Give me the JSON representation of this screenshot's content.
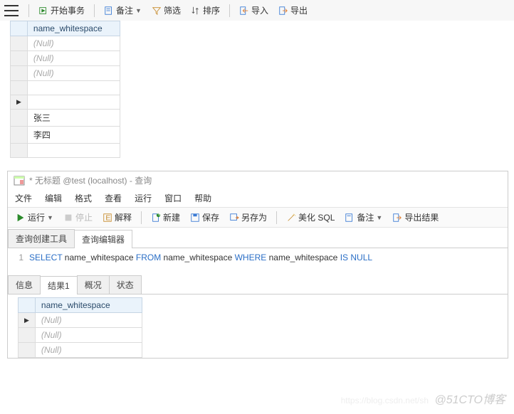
{
  "top_toolbar": {
    "begin_tx": "开始事务",
    "memo": "备注",
    "filter": "筛选",
    "sort": "排序",
    "import": "导入",
    "export": "导出"
  },
  "top_grid": {
    "header": "name_whitespace",
    "rows": [
      {
        "val": "(Null)",
        "null": true,
        "active": false
      },
      {
        "val": "(Null)",
        "null": true,
        "active": false
      },
      {
        "val": "(Null)",
        "null": true,
        "active": false
      },
      {
        "val": "",
        "null": false,
        "active": false
      },
      {
        "val": "",
        "null": false,
        "active": true
      },
      {
        "val": "张三",
        "null": false,
        "active": false
      },
      {
        "val": "李四",
        "null": false,
        "active": false
      },
      {
        "val": "",
        "null": false,
        "active": false
      }
    ]
  },
  "query_window": {
    "title": "* 无标题 @test (localhost) - 查询",
    "menus": [
      "文件",
      "编辑",
      "格式",
      "查看",
      "运行",
      "窗口",
      "帮助"
    ],
    "toolbar": {
      "run": "运行",
      "stop": "停止",
      "explain": "解释",
      "new": "新建",
      "save": "保存",
      "save_as": "另存为",
      "beautify": "美化 SQL",
      "memo": "备注",
      "export_result": "导出结果"
    },
    "tabs": [
      "查询创建工具",
      "查询编辑器"
    ],
    "active_tab": 1,
    "editor": {
      "line_no": "1",
      "tokens": [
        {
          "t": "SELECT",
          "k": true
        },
        {
          "t": " name_whitespace ",
          "k": false
        },
        {
          "t": "FROM",
          "k": true
        },
        {
          "t": " name_whitespace ",
          "k": false
        },
        {
          "t": "WHERE",
          "k": true
        },
        {
          "t": " name_whitespace ",
          "k": false
        },
        {
          "t": "IS",
          "k": true
        },
        {
          "t": " ",
          "k": false
        },
        {
          "t": "NULL",
          "k": true
        }
      ]
    },
    "result_tabs": [
      "信息",
      "结果1",
      "概况",
      "状态"
    ],
    "result_active": 1,
    "result_grid": {
      "header": "name_whitespace",
      "rows": [
        {
          "val": "(Null)",
          "null": true,
          "active": true
        },
        {
          "val": "(Null)",
          "null": true,
          "active": false
        },
        {
          "val": "(Null)",
          "null": true,
          "active": false
        }
      ]
    }
  },
  "watermark": "@51CTO博客",
  "watermark2": "https://blog.csdn.net/sh"
}
